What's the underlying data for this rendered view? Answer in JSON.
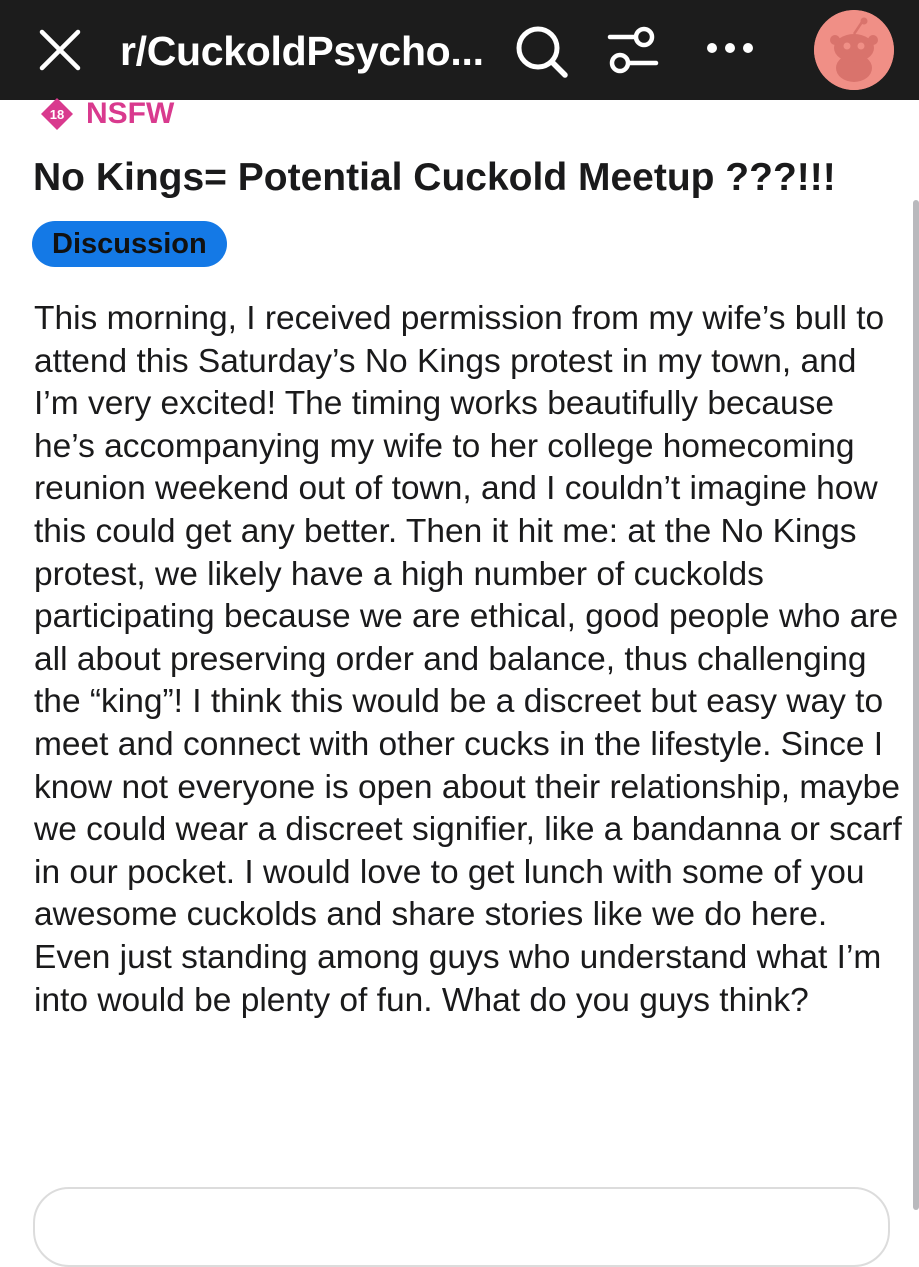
{
  "header": {
    "subreddit": "r/CuckoldPsycho...",
    "close_icon": "close-icon",
    "search_icon": "search-icon",
    "filter_icon": "filter-icon",
    "more_icon": "more-icon"
  },
  "post": {
    "nsfw_age": "18",
    "nsfw_label": "NSFW",
    "title": "No Kings= Potential Cuckold Meetup ???!!!",
    "flair": "Discussion",
    "body": "This morning, I received permission from my wife’s bull to attend this Saturday’s No Kings protest in my town, and I’m very excited! The timing works beautifully because he’s accompanying my wife to her college homecoming reunion weekend out of town, and I couldn’t imagine how this could get any better. Then it hit me: at the No Kings protest, we likely have a high number of cuckolds participating because we are ethical, good people who are all about preserving order and balance, thus challenging the “king”! I think this would be a discreet but easy way to meet and connect with other cucks in the lifestyle. Since I know not everyone is open about their relationship, maybe we could wear a discreet signifier, like a bandanna or scarf in our pocket. I would love to get lunch with some of you awesome cuckolds and share stories like we do here. Even just standing among guys who understand what I’m into would be plenty of fun. What do you guys think?"
  },
  "colors": {
    "topbar": "#1c1c1c",
    "nsfw": "#d93a8e",
    "flair": "#1479e6",
    "avatar": "#f08f86"
  }
}
